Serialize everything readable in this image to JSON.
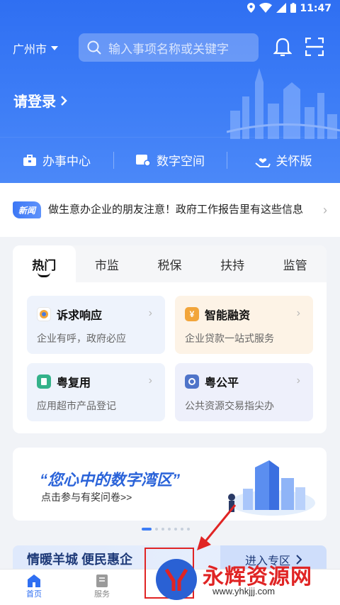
{
  "status_bar": {
    "time": "11:47"
  },
  "header": {
    "city": "广州市",
    "search_placeholder": "输入事项名称或关键字",
    "login_label": "请登录"
  },
  "quick_nav": [
    {
      "label": "办事中心",
      "icon": "briefcase-icon"
    },
    {
      "label": "数字空间",
      "icon": "digital-space-icon"
    },
    {
      "label": "关怀版",
      "icon": "care-hand-icon"
    }
  ],
  "news": {
    "badge": "新闻",
    "text": "做生意办企业的朋友注意！政府工作报告里有这些信息"
  },
  "tabs": [
    {
      "label": "热门",
      "active": true
    },
    {
      "label": "市监"
    },
    {
      "label": "税保"
    },
    {
      "label": "扶持"
    },
    {
      "label": "监管"
    }
  ],
  "services": [
    {
      "title": "诉求响应",
      "subtitle": "企业有呼，政府必应",
      "icon": "appeal-icon",
      "color": "#f2a53a",
      "bg": "#eef3fc"
    },
    {
      "title": "智能融资",
      "subtitle": "企业贷款一站式服务",
      "icon": "yen-icon",
      "color": "#f2a53a",
      "bg": "#fdf3e6",
      "icon_text": "¥"
    },
    {
      "title": "粤复用",
      "subtitle": "应用超市产品登记",
      "icon": "reuse-icon",
      "color": "#34b28a",
      "bg": "#eef3fc"
    },
    {
      "title": "粤公平",
      "subtitle": "公共资源交易指尖办",
      "icon": "fairness-icon",
      "color": "#4f74c9",
      "bg": "#eef0fb"
    }
  ],
  "banner": {
    "title": "“您心中的数字湾区”",
    "subtitle": "点击参与有奖问卷>>"
  },
  "promo": {
    "title": "情暖羊城 便民惠企",
    "enter_label": "进入专区"
  },
  "bottom_nav": [
    {
      "label": "首页",
      "icon": "home-icon",
      "active": true
    },
    {
      "label": "服务",
      "icon": "service-icon"
    }
  ],
  "watermark": {
    "text": "永辉资源网",
    "url": "www.yhkjjj.com"
  },
  "colors": {
    "primary": "#2f6ff2",
    "annotation": "#e02424"
  }
}
